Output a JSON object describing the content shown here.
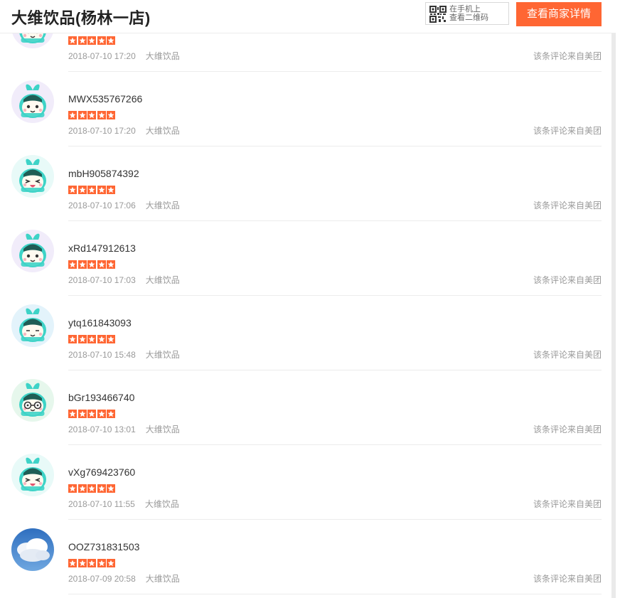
{
  "header": {
    "title": "大维饮品(杨林一店)",
    "qr_line1": "在手机上",
    "qr_line2": "查看二维码",
    "detail_button": "查看商家详情"
  },
  "colors": {
    "accent": "#ff6633",
    "muted": "#999999",
    "text": "#333333"
  },
  "reviews": [
    {
      "username": "",
      "rating": 5,
      "datetime": "2018-07-10 17:20",
      "shop": "大维饮品",
      "source": "该条评论来自美团",
      "avatar": "mascot-smile"
    },
    {
      "username": "MWX535767266",
      "rating": 5,
      "datetime": "2018-07-10 17:20",
      "shop": "大维饮品",
      "source": "该条评论来自美团",
      "avatar": "mascot-smile"
    },
    {
      "username": "mbH905874392",
      "rating": 5,
      "datetime": "2018-07-10 17:06",
      "shop": "大维饮品",
      "source": "该条评论来自美团",
      "avatar": "mascot-wink"
    },
    {
      "username": "xRd147912613",
      "rating": 5,
      "datetime": "2018-07-10 17:03",
      "shop": "大维饮品",
      "source": "该条评论来自美团",
      "avatar": "mascot-smile"
    },
    {
      "username": "ytq161843093",
      "rating": 5,
      "datetime": "2018-07-10 15:48",
      "shop": "大维饮品",
      "source": "该条评论来自美团",
      "avatar": "mascot-calm"
    },
    {
      "username": "bGr193466740",
      "rating": 5,
      "datetime": "2018-07-10 13:01",
      "shop": "大维饮品",
      "source": "该条评论来自美团",
      "avatar": "mascot-glasses"
    },
    {
      "username": "vXg769423760",
      "rating": 5,
      "datetime": "2018-07-10 11:55",
      "shop": "大维饮品",
      "source": "该条评论来自美团",
      "avatar": "mascot-wink"
    },
    {
      "username": "OOZ731831503",
      "rating": 5,
      "datetime": "2018-07-09 20:58",
      "shop": "大维饮品",
      "source": "该条评论来自美团",
      "avatar": "cloud-photo"
    }
  ]
}
